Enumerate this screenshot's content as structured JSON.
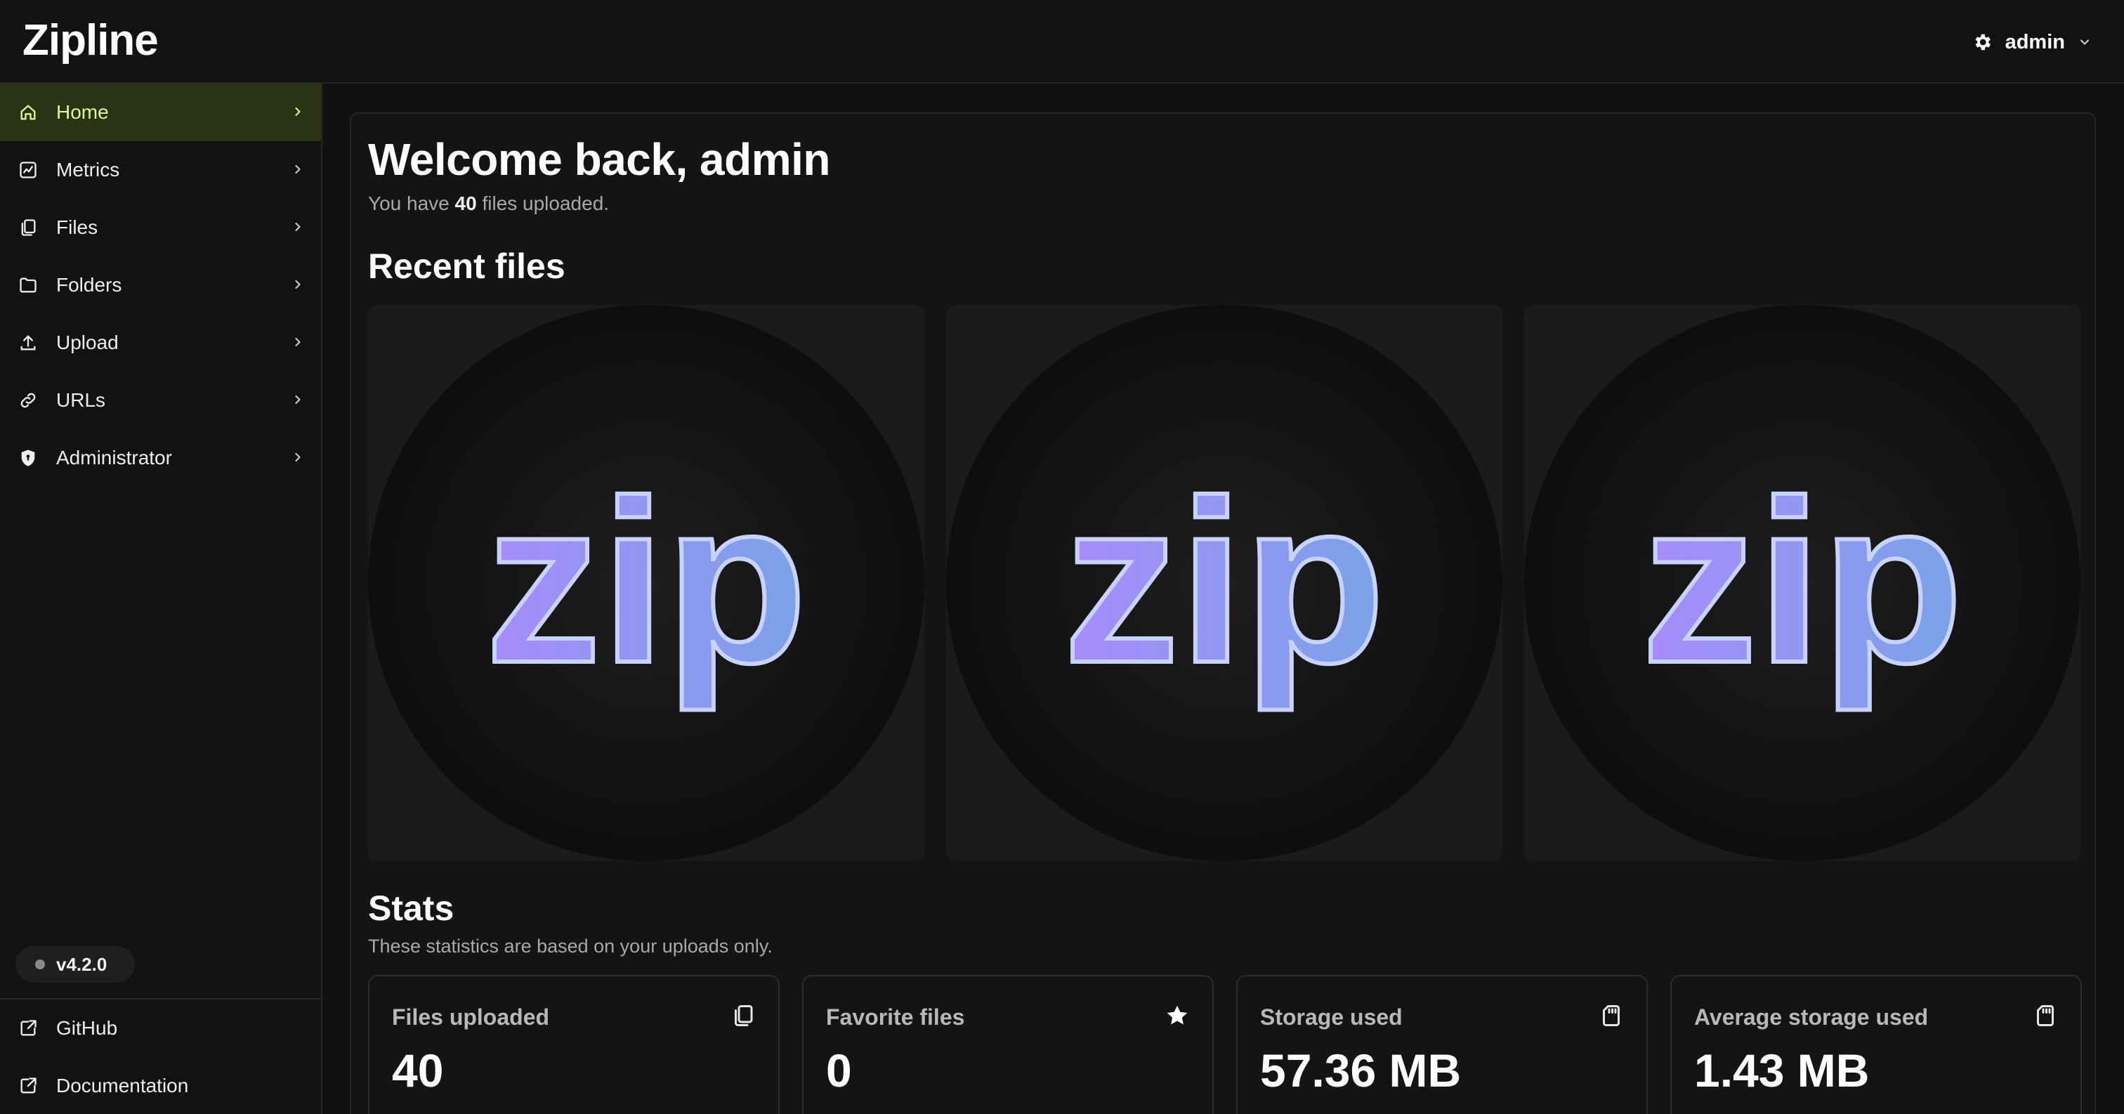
{
  "app": {
    "brand": "Zipline"
  },
  "header": {
    "user": "admin"
  },
  "sidebar": {
    "items": [
      {
        "label": "Home",
        "icon": "home-icon",
        "active": true
      },
      {
        "label": "Metrics",
        "icon": "metrics-icon"
      },
      {
        "label": "Files",
        "icon": "files-icon"
      },
      {
        "label": "Folders",
        "icon": "folder-icon"
      },
      {
        "label": "Upload",
        "icon": "upload-icon"
      },
      {
        "label": "URLs",
        "icon": "link-icon"
      },
      {
        "label": "Administrator",
        "icon": "shield-icon"
      }
    ],
    "version": "v4.2.0",
    "footer_links": [
      {
        "label": "GitHub",
        "icon": "external-link-icon"
      },
      {
        "label": "Documentation",
        "icon": "external-link-icon"
      }
    ]
  },
  "main": {
    "welcome": "Welcome back, admin",
    "subtitle_prefix": "You have",
    "file_count": "40",
    "subtitle_suffix": "files uploaded.",
    "recent_title": "Recent files",
    "recent_files": [
      {
        "thumbnail_text": "zip"
      },
      {
        "thumbnail_text": "zip"
      },
      {
        "thumbnail_text": "zip"
      }
    ],
    "stats_title": "Stats",
    "stats_desc": "These statistics are based on your uploads only.",
    "stats": [
      {
        "title": "Files uploaded",
        "value": "40",
        "icon": "files-icon"
      },
      {
        "title": "Favorite files",
        "value": "0",
        "icon": "star-icon"
      },
      {
        "title": "Storage used",
        "value": "57.36 MB",
        "icon": "sd-card-icon"
      },
      {
        "title": "Average storage used",
        "value": "1.43 MB",
        "icon": "sd-card-icon"
      }
    ]
  },
  "colors": {
    "active_bg": "#2a3314",
    "active_text": "#d9f99d",
    "logo_purple": "#a78bfa",
    "logo_blue": "#7aa2e8"
  }
}
